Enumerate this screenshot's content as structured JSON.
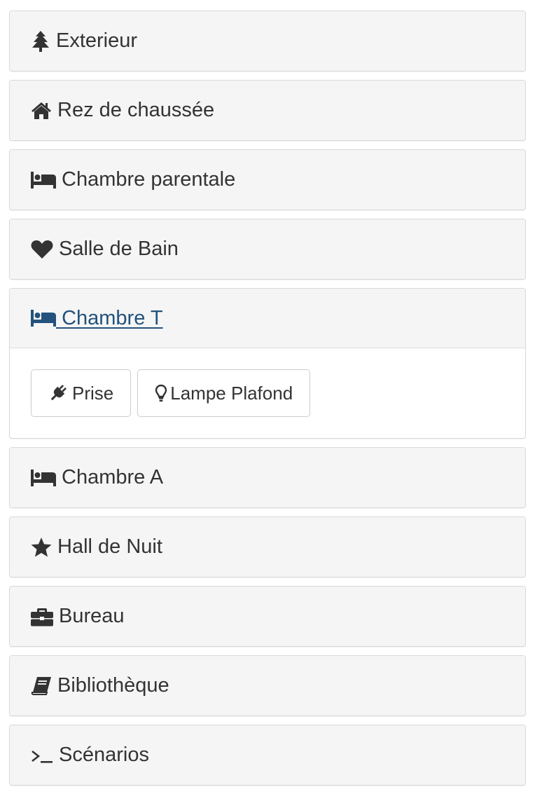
{
  "rooms": [
    {
      "label": "Exterieur",
      "icon": "tree-icon",
      "open": false
    },
    {
      "label": "Rez de chaussée",
      "icon": "home-icon",
      "open": false
    },
    {
      "label": "Chambre parentale",
      "icon": "bed-icon",
      "open": false
    },
    {
      "label": "Salle de Bain",
      "icon": "heart-icon",
      "open": false
    },
    {
      "label": "Chambre T",
      "icon": "bed-icon",
      "open": true,
      "devices": [
        {
          "label": "Prise",
          "icon": "plug-icon"
        },
        {
          "label": "Lampe Plafond",
          "icon": "lightbulb-icon"
        }
      ]
    },
    {
      "label": "Chambre A",
      "icon": "bed-icon",
      "open": false
    },
    {
      "label": "Hall de Nuit",
      "icon": "star-icon",
      "open": false
    },
    {
      "label": "Bureau",
      "icon": "briefcase-icon",
      "open": false
    },
    {
      "label": "Bibliothèque",
      "icon": "book-icon",
      "open": false
    },
    {
      "label": "Scénarios",
      "icon": "terminal-icon",
      "open": false
    }
  ],
  "colors": {
    "panel_heading_bg": "#f5f5f5",
    "panel_border": "#d9d9d9",
    "text": "#333333",
    "active_link": "#23527c"
  }
}
